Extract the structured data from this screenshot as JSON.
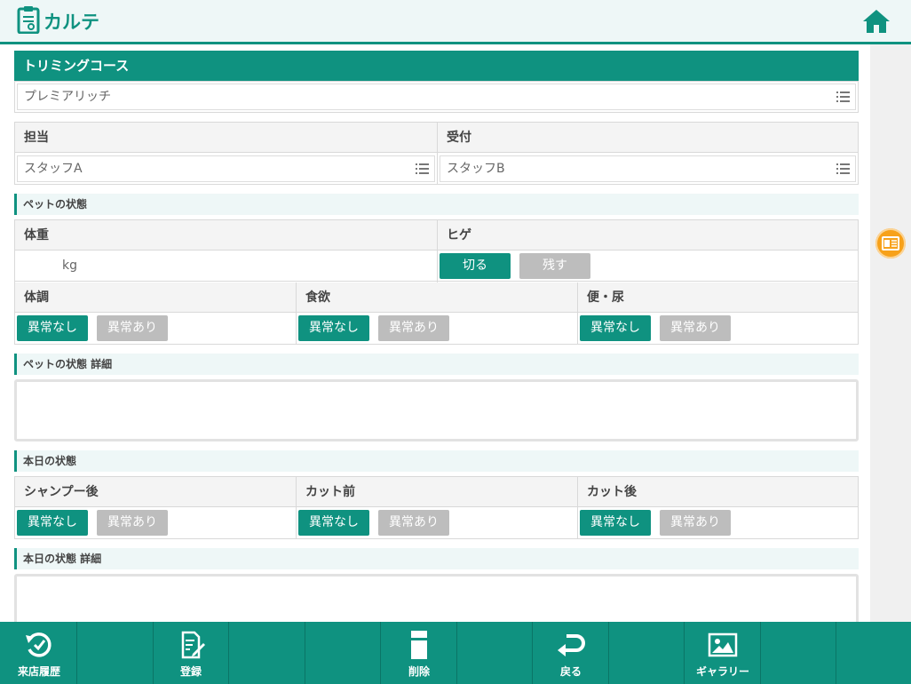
{
  "header": {
    "title": "カルテ"
  },
  "trimming": {
    "heading": "トリミングコース",
    "value": "プレミアリッチ"
  },
  "staff": {
    "tanto_label": "担当",
    "tanto_value": "スタッフA",
    "uketsuke_label": "受付",
    "uketsuke_value": "スタッフB"
  },
  "pet": {
    "heading": "ペットの状態",
    "weight_label": "体重",
    "weight_unit": "kg",
    "whisker_label": "ヒゲ",
    "whisker_cut": "切る",
    "whisker_keep": "残す",
    "taicho_label": "体調",
    "shokuyoku_label": "食欲",
    "ben_label": "便・尿",
    "detail_heading": "ペットの状態 詳細"
  },
  "today": {
    "heading": "本日の状態",
    "shampoo_label": "シャンプー後",
    "cut_before_label": "カット前",
    "cut_after_label": "カット後",
    "detail_heading": "本日の状態 詳細"
  },
  "buttons": {
    "normal": "異常なし",
    "abnormal": "異常あり"
  },
  "footer": {
    "history": "来店履歴",
    "register": "登録",
    "delete": "削除",
    "back": "戻る",
    "gallery": "ギャラリー"
  },
  "colors": {
    "accent": "#0f9280",
    "inactive": "#bdbdbd",
    "badge": "#f7a11a"
  }
}
